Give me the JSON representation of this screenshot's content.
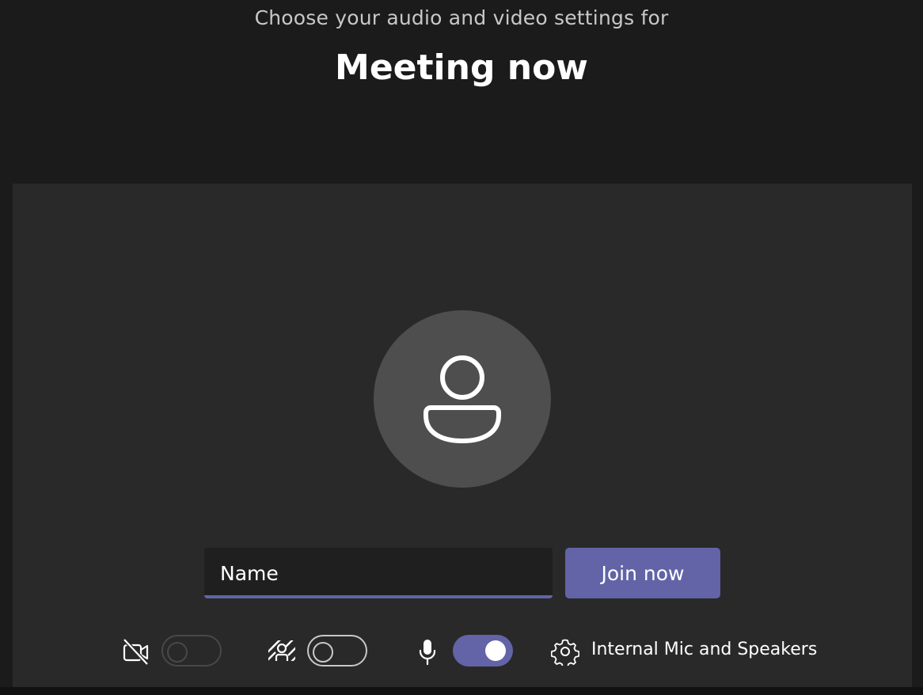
{
  "header": {
    "subtitle": "Choose your audio and video settings for",
    "title": "Meeting now"
  },
  "preview": {
    "avatar_icon": "person-icon"
  },
  "join_form": {
    "name_placeholder": "Name",
    "name_value": "",
    "join_label": "Join now"
  },
  "controls": {
    "video": {
      "icon": "video-off-icon",
      "enabled": false,
      "disabled": true
    },
    "background_effects": {
      "icon": "background-blur-icon",
      "enabled": false
    },
    "microphone": {
      "icon": "microphone-icon",
      "enabled": true
    },
    "device_settings": {
      "icon": "gear-icon",
      "label": "Internal Mic and Speakers"
    }
  },
  "colors": {
    "accent": "#6264a7",
    "background": "#1b1b1b",
    "panel": "#292929",
    "avatar": "#4e4e4e"
  }
}
